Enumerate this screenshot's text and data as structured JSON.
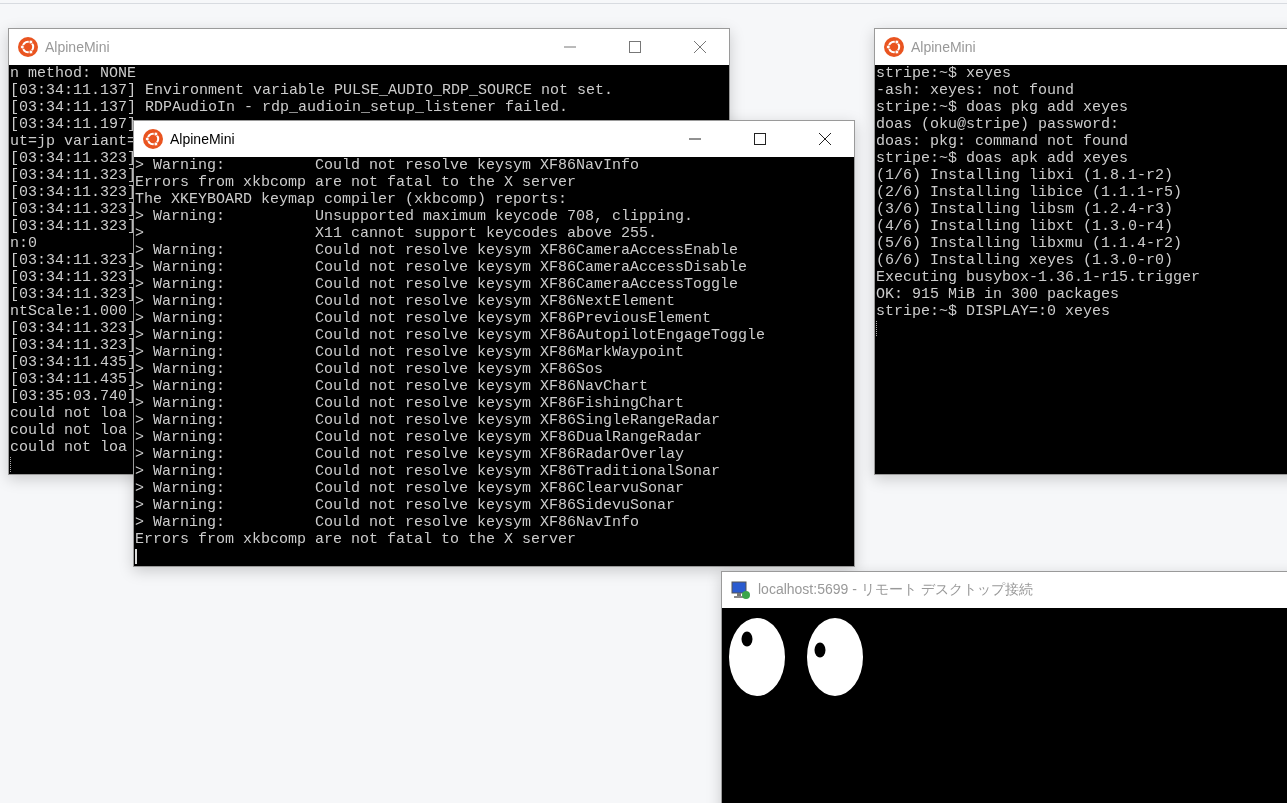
{
  "windows": [
    {
      "kind": "terminal",
      "title": "AlpineMini",
      "active": false,
      "buttons": [
        {
          "kind": "minimize"
        },
        {
          "kind": "maximize"
        },
        {
          "kind": "close"
        }
      ],
      "lines": [
        "n method: NONE",
        "[03:34:11.137] Environment variable PULSE_AUDIO_RDP_SOURCE not set.",
        "[03:34:11.137] RDPAudioIn - rdp_audioin_setup_listener failed.",
        "[03:34:11.197]",
        "ut=jp variant=",
        "[03:34:11.323]",
        "[03:34:11.323]",
        "[03:34:11.323]",
        "[03:34:11.323]",
        "[03:34:11.323]",
        "n:0",
        "[03:34:11.323]",
        "[03:34:11.323]",
        "[03:34:11.323]",
        "ntScale:1.000",
        "[03:34:11.323]",
        "[03:34:11.323]",
        "[03:34:11.435]",
        "[03:34:11.435]",
        "[03:35:03.740]",
        "could not loa",
        "could not loa",
        "could not loa"
      ],
      "dotted_cursor": true
    },
    {
      "kind": "terminal",
      "title": "AlpineMini",
      "active": true,
      "buttons": [
        {
          "kind": "minimize"
        },
        {
          "kind": "maximize"
        },
        {
          "kind": "close"
        }
      ],
      "lines": [
        "> Warning:          Could not resolve keysym XF86NavInfo",
        "Errors from xkbcomp are not fatal to the X server",
        "The XKEYBOARD keymap compiler (xkbcomp) reports:",
        "> Warning:          Unsupported maximum keycode 708, clipping.",
        ">                   X11 cannot support keycodes above 255.",
        "> Warning:          Could not resolve keysym XF86CameraAccessEnable",
        "> Warning:          Could not resolve keysym XF86CameraAccessDisable",
        "> Warning:          Could not resolve keysym XF86CameraAccessToggle",
        "> Warning:          Could not resolve keysym XF86NextElement",
        "> Warning:          Could not resolve keysym XF86PreviousElement",
        "> Warning:          Could not resolve keysym XF86AutopilotEngageToggle",
        "> Warning:          Could not resolve keysym XF86MarkWaypoint",
        "> Warning:          Could not resolve keysym XF86Sos",
        "> Warning:          Could not resolve keysym XF86NavChart",
        "> Warning:          Could not resolve keysym XF86FishingChart",
        "> Warning:          Could not resolve keysym XF86SingleRangeRadar",
        "> Warning:          Could not resolve keysym XF86DualRangeRadar",
        "> Warning:          Could not resolve keysym XF86RadarOverlay",
        "> Warning:          Could not resolve keysym XF86TraditionalSonar",
        "> Warning:          Could not resolve keysym XF86ClearvuSonar",
        "> Warning:          Could not resolve keysym XF86SidevuSonar",
        "> Warning:          Could not resolve keysym XF86NavInfo",
        "Errors from xkbcomp are not fatal to the X server"
      ],
      "dotted_cursor": false
    },
    {
      "kind": "terminal",
      "title": "AlpineMini",
      "active": false,
      "lines": [
        "stripe:~$ xeyes",
        "-ash: xeyes: not found",
        "stripe:~$ doas pkg add xeyes",
        "doas (oku@stripe) password:",
        "doas: pkg: command not found",
        "stripe:~$ doas apk add xeyes",
        "(1/6) Installing libxi (1.8.1-r2)",
        "(2/6) Installing libice (1.1.1-r5)",
        "(3/6) Installing libsm (1.2.4-r3)",
        "(4/6) Installing libxt (1.3.0-r4)",
        "(5/6) Installing libxmu (1.1.4-r2)",
        "(6/6) Installing xeyes (1.3.0-r0)",
        "Executing busybox-1.36.1-r15.trigger",
        "OK: 915 MiB in 300 packages",
        "stripe:~$ DISPLAY=:0 xeyes"
      ],
      "dotted_cursor": true
    },
    {
      "kind": "viewer",
      "title": "localhost:5699 - リモート デスクトップ接続",
      "active": false
    }
  ]
}
